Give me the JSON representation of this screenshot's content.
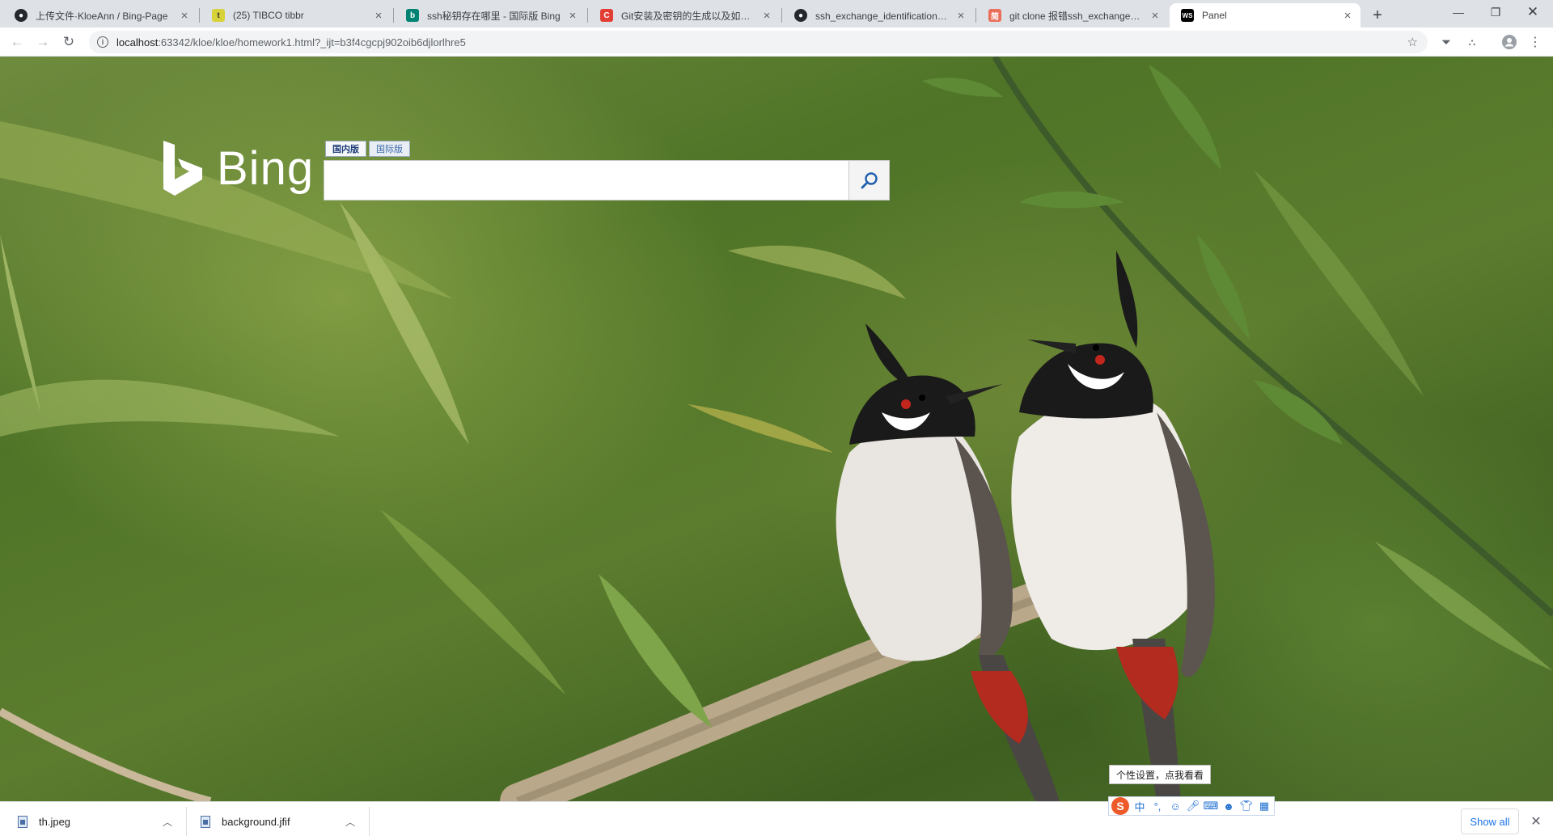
{
  "browser": {
    "tabs": [
      {
        "title": "上传文件·KloeAnn / Bing-Page",
        "icon": "github-icon"
      },
      {
        "title": "(25) TIBCO tibbr",
        "icon": "tibbr-icon"
      },
      {
        "title": "ssh秘钥存在哪里 - 国际版 Bing",
        "icon": "bing-icon"
      },
      {
        "title": "Git安装及密钥的生成以及如何重",
        "icon": "csdn-icon"
      },
      {
        "title": "ssh_exchange_identification：读",
        "icon": "github-icon"
      },
      {
        "title": "git clone 报错ssh_exchange_iden",
        "icon": "jianshu-icon"
      },
      {
        "title": "Panel",
        "icon": "webstorm-icon"
      }
    ],
    "new_tab_symbol": "+",
    "url_host": "localhost",
    "url_rest": ":63342/kloe/kloe/homework1.html?_ijt=b3f4cgcpj902oib6djlorlhre5",
    "colors": {
      "tabstrip": "#dee1e6",
      "accent": "#1a73e8"
    }
  },
  "page": {
    "logo_text": "Bing",
    "scope_tabs": [
      {
        "label": "国内版",
        "selected": true
      },
      {
        "label": "国际版",
        "selected": false
      }
    ],
    "search": {
      "value": "",
      "placeholder": ""
    },
    "tooltip": "个性设置，点我看看"
  },
  "ime": {
    "logo": "S",
    "items": [
      "中",
      "°,",
      "☺",
      "mic-icon",
      "keyboard-icon",
      "user-icon",
      "shirt-icon",
      "grid-icon"
    ]
  },
  "downloads": {
    "items": [
      {
        "name": "th.jpeg"
      },
      {
        "name": "background.jfif"
      }
    ],
    "show_all": "Show all"
  }
}
